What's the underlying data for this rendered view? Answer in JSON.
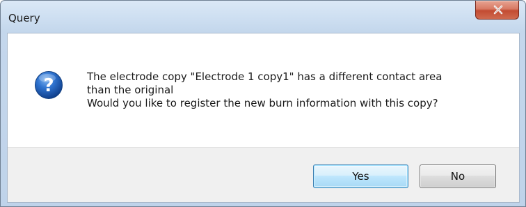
{
  "window": {
    "title": "Query"
  },
  "titlebar": {
    "close_icon": "close-icon"
  },
  "message": {
    "icon": "question-icon",
    "lines": [
      "The electrode copy \"Electrode 1 copy1\" has a different contact area",
      "than the original",
      "Would you like to register the new burn information with this copy?"
    ]
  },
  "buttons": {
    "yes_label": "Yes",
    "no_label": "No"
  },
  "colors": {
    "close_button": "#c24b32",
    "question_icon": "#1e62c0",
    "default_button_border": "#3c7fb1",
    "footer_background": "#f0f0f0"
  }
}
